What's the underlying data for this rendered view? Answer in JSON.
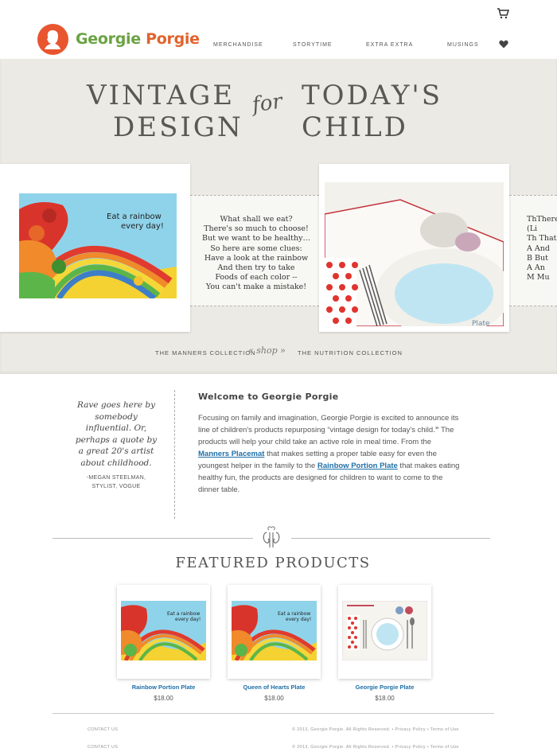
{
  "header": {
    "brand_part1": "Georgie",
    "brand_part2": "Porgie",
    "nav": [
      "MERCHANDISE",
      "STORYTIME",
      "EXTRA EXTRA",
      "MUSINGS"
    ],
    "cart_icon": "cart-icon",
    "wishlist_icon": "heart-icon"
  },
  "hero": {
    "line1_left": "VINTAGE",
    "line1_right": "TODAY'S",
    "line2_left": "DESIGN",
    "line2_right": "CHILD",
    "connector": "for",
    "card1_caption_line1": "Eat a rainbow",
    "card1_caption_line2": "every day!",
    "poem": [
      "What shall we eat?",
      "There's so much to choose!",
      "But we want to be healthy…",
      "So here are some clues:",
      "Have a look at the rainbow",
      "And then try to take",
      "Foods of each color --",
      "You can't make a mistake!"
    ],
    "poem2": [
      "Th",
      "(Li",
      "Th",
      "A",
      "B",
      "A",
      "M"
    ],
    "poem2_tail": [
      "There",
      "",
      "That",
      "And",
      "But",
      "An",
      "Mu"
    ],
    "card2_plate_text": "Plate",
    "collection_left": "THE MANNERS COLLECTION",
    "shop": "shop",
    "collection_right": "THE NUTRITION COLLECTION"
  },
  "quote": {
    "text": "Rave goes here by somebody influential. Or, perhaps a quote by a great 20's artist about childhood.",
    "author": "-MEGAN STEELMAN,",
    "role": "STYLIST, VOGUE"
  },
  "welcome": {
    "title": "Welcome to Georgie Porgie",
    "p1": "Focusing on family and imagination, Georgie Porgie is excited to announce its line of children's products repurposing “vintage design for today's child.",
    "p1_end": "”",
    "p2": " The products will help your child take an active role in meal time. From the ",
    "link1": "Manners Placemat",
    "p3": " that makes setting a proper table easy for even the youngest helper in the family to the ",
    "link2": "Rainbow Portion Plate",
    "p4": " that makes eating healthy fun, the products are designed for children to want to come to the dinner table."
  },
  "featured": {
    "title": "FEATURED PRODUCTS",
    "products": [
      {
        "name": "Rainbow Portion Plate",
        "price": "$18.00",
        "caption1": "Eat a rainbow",
        "caption2": "every day!"
      },
      {
        "name": "Queen of Hearts Plate",
        "price": "$18.00",
        "caption1": "Eat a rainbow",
        "caption2": "every day!"
      },
      {
        "name": "Georgie Porgie Plate",
        "price": "$18.00"
      }
    ]
  },
  "footer": {
    "contact": "CONTACT US",
    "copyright": "© 2013, Georgie Porgie. All Rights Reserved.",
    "privacy": "Privacy Policy",
    "terms": "Terms of Use",
    "sep": "•"
  },
  "colors": {
    "accent_orange": "#e8552f",
    "brand_green": "#6aa342",
    "link_blue": "#1f6fa8",
    "hero_bg": "#ebeae4"
  }
}
